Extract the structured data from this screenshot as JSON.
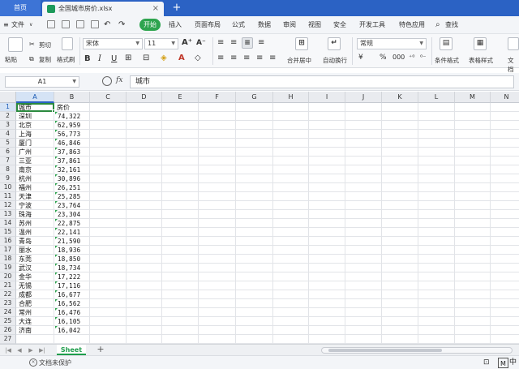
{
  "tabs": {
    "home": "首页",
    "document": "全国城市房价.xlsx",
    "add": "+"
  },
  "menu": {
    "file": "文件",
    "file_arrow": "∨",
    "items": [
      "开始",
      "插入",
      "页面布局",
      "公式",
      "数据",
      "审阅",
      "视图",
      "安全",
      "开发工具",
      "特色应用"
    ],
    "search": "查找"
  },
  "ribbon": {
    "paste": "粘贴",
    "cut": "剪切",
    "copy": "复制",
    "format_painter": "格式刷",
    "font_name": "宋体",
    "font_size": "11",
    "bold": "B",
    "italic": "I",
    "underline": "U",
    "merge_center": "合并居中",
    "wrap_text": "自动换行",
    "number_format": "常规",
    "conditional_format": "条件格式",
    "table_style": "表格样式",
    "doc_tools": "文档"
  },
  "formula_bar": {
    "cell_ref": "A1",
    "fx": "fx",
    "content": "城市"
  },
  "columns": [
    "A",
    "B",
    "C",
    "D",
    "E",
    "F",
    "G",
    "H",
    "I",
    "J",
    "K",
    "L",
    "M",
    "N"
  ],
  "active_column": "A",
  "rows": [
    {
      "n": "1",
      "a": "城市",
      "b": "房价"
    },
    {
      "n": "2",
      "a": "深圳",
      "b": "74,322"
    },
    {
      "n": "3",
      "a": "北京",
      "b": "62,959"
    },
    {
      "n": "4",
      "a": "上海",
      "b": "56,773"
    },
    {
      "n": "5",
      "a": "厦门",
      "b": "46,846"
    },
    {
      "n": "6",
      "a": "广州",
      "b": "37,863"
    },
    {
      "n": "7",
      "a": "三亚",
      "b": "37,861"
    },
    {
      "n": "8",
      "a": "南京",
      "b": "32,161"
    },
    {
      "n": "9",
      "a": "杭州",
      "b": "30,896"
    },
    {
      "n": "10",
      "a": "福州",
      "b": "26,251"
    },
    {
      "n": "11",
      "a": "天津",
      "b": "25,285"
    },
    {
      "n": "12",
      "a": "宁波",
      "b": "23,764"
    },
    {
      "n": "13",
      "a": "珠海",
      "b": "23,304"
    },
    {
      "n": "14",
      "a": "苏州",
      "b": "22,875"
    },
    {
      "n": "15",
      "a": "温州",
      "b": "22,141"
    },
    {
      "n": "16",
      "a": "青岛",
      "b": "21,590"
    },
    {
      "n": "17",
      "a": "丽水",
      "b": "18,936"
    },
    {
      "n": "18",
      "a": "东莞",
      "b": "18,850"
    },
    {
      "n": "19",
      "a": "武汉",
      "b": "18,734"
    },
    {
      "n": "20",
      "a": "金华",
      "b": "17,222"
    },
    {
      "n": "21",
      "a": "无锡",
      "b": "17,116"
    },
    {
      "n": "22",
      "a": "成都",
      "b": "16,677"
    },
    {
      "n": "23",
      "a": "合肥",
      "b": "16,562"
    },
    {
      "n": "24",
      "a": "常州",
      "b": "16,476"
    },
    {
      "n": "25",
      "a": "大连",
      "b": "16,105"
    },
    {
      "n": "26",
      "a": "济南",
      "b": "16,042"
    },
    {
      "n": "27",
      "a": "",
      "b": ""
    }
  ],
  "sheet_tab": "Sheet",
  "add_sheet": "+",
  "status": {
    "protect": "文档未保护",
    "ime_m": "M",
    "ime_cn": "中"
  },
  "colors": {
    "accent_blue": "#2b62c4",
    "start_green": "#2ea44f",
    "selection_green": "#2b8a3e"
  }
}
